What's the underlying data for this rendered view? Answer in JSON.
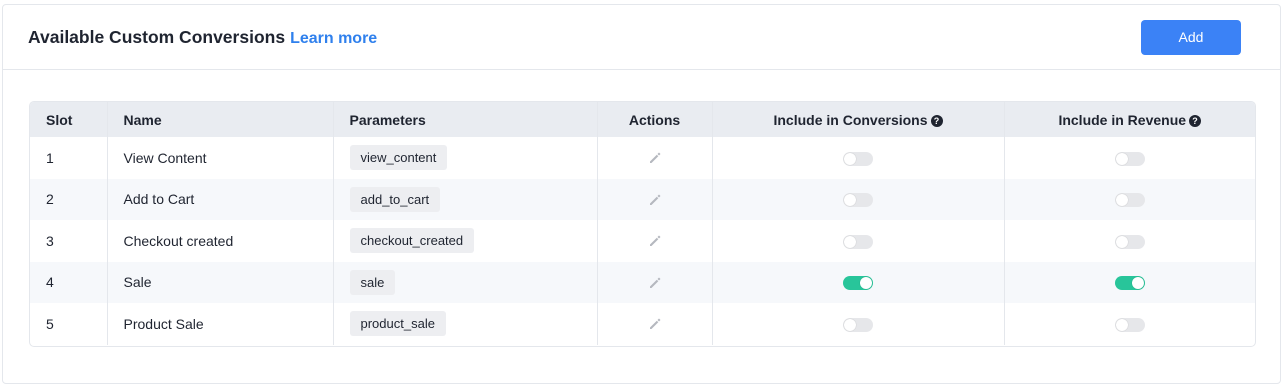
{
  "header": {
    "title": "Available Custom Conversions",
    "learn_more": "Learn more",
    "add_label": "Add"
  },
  "table": {
    "columns": {
      "slot": "Slot",
      "name": "Name",
      "parameters": "Parameters",
      "actions": "Actions",
      "include_conversions": "Include in Conversions",
      "include_revenue": "Include in Revenue"
    },
    "rows": [
      {
        "slot": "1",
        "name": "View Content",
        "parameter": "view_content",
        "include_conversions": false,
        "include_revenue": false
      },
      {
        "slot": "2",
        "name": "Add to Cart",
        "parameter": "add_to_cart",
        "include_conversions": false,
        "include_revenue": false
      },
      {
        "slot": "3",
        "name": "Checkout created",
        "parameter": "checkout_created",
        "include_conversions": false,
        "include_revenue": false
      },
      {
        "slot": "4",
        "name": "Sale",
        "parameter": "sale",
        "include_conversions": true,
        "include_revenue": true
      },
      {
        "slot": "5",
        "name": "Product Sale",
        "parameter": "product_sale",
        "include_conversions": false,
        "include_revenue": false
      }
    ]
  },
  "icons": {
    "help": "question-circle-icon",
    "edit": "pencil-icon"
  },
  "colors": {
    "accent": "#3b82f6",
    "link": "#2f80ed",
    "toggle_on": "#28c59a",
    "toggle_off": "#e6e7ea"
  }
}
